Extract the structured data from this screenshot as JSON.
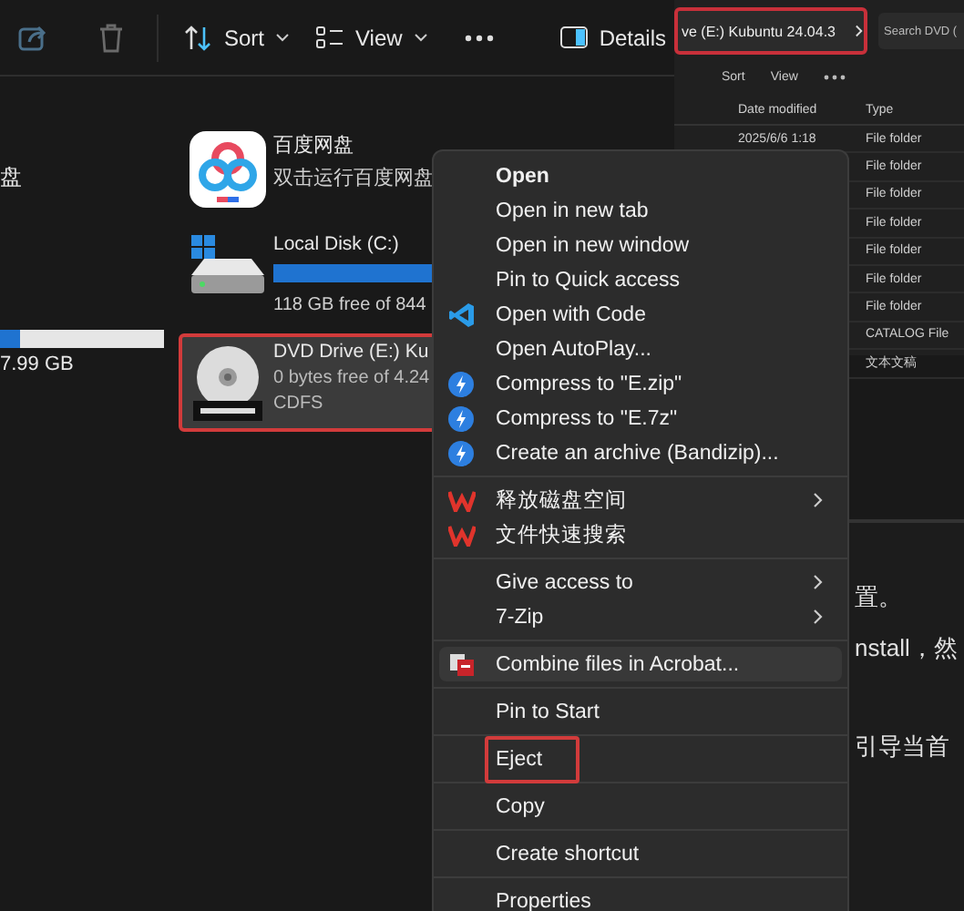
{
  "toolbar": {
    "sort": "Sort",
    "view": "View",
    "details": "Details"
  },
  "left_panel": {
    "label": "盘",
    "storage": {
      "level": 0.12
    },
    "storage_text": "7.99 GB"
  },
  "drives": [
    {
      "kind": "app",
      "name": "百度网盘",
      "lines": [
        "双击运行百度网盘"
      ],
      "selected": false,
      "marked": false
    },
    {
      "kind": "disk",
      "name": "Local Disk (C:)",
      "level": 0.86,
      "lines": [
        "118 GB free of 844"
      ],
      "selected": false,
      "marked": false
    },
    {
      "kind": "dvd",
      "name": "DVD Drive (E:) Ku",
      "lines": [
        "0 bytes free of 4.24",
        "CDFS"
      ],
      "selected": true,
      "marked": true
    }
  ],
  "inset_window": {
    "address": "ve (E:) Kubuntu 24.04.3",
    "address_marked": true,
    "search_placeholder": "Search DVD (",
    "sort": "Sort",
    "view": "View",
    "columns": [
      "Date modified",
      "Type"
    ],
    "rows": [
      {
        "date": "2025/6/6 1:18",
        "type": "File folder"
      },
      {
        "type": "File folder"
      },
      {
        "type": "File folder"
      },
      {
        "type": "File folder"
      },
      {
        "type": "File folder"
      },
      {
        "type": "File folder"
      },
      {
        "type": "File folder"
      },
      {
        "type": "CATALOG File"
      },
      {
        "type": "文本文稿"
      }
    ]
  },
  "document_lines": [
    "置。",
    "nstall，然",
    "引导当首"
  ],
  "context_menu": {
    "groups": [
      [
        {
          "label": "Open",
          "kind": "plain",
          "submenu": false,
          "selected": false,
          "marked": false
        },
        {
          "label": "Open in new tab",
          "kind": "plain",
          "submenu": false,
          "selected": false,
          "marked": false
        },
        {
          "label": "Open in new window",
          "kind": "plain",
          "submenu": false,
          "selected": false,
          "marked": false
        },
        {
          "label": "Pin to Quick access",
          "kind": "plain",
          "submenu": false,
          "selected": false,
          "marked": false
        },
        {
          "label": "Open with Code",
          "kind": "code",
          "submenu": false,
          "selected": false,
          "marked": false
        },
        {
          "label": "Open AutoPlay...",
          "kind": "plain",
          "submenu": false,
          "selected": false,
          "marked": false
        },
        {
          "label": "Compress to \"E.zip\"",
          "kind": "bandizip",
          "submenu": false,
          "selected": false,
          "marked": false
        },
        {
          "label": "Compress to \"E.7z\"",
          "kind": "bandizip",
          "submenu": false,
          "selected": false,
          "marked": false
        },
        {
          "label": "Create an archive (Bandizip)...",
          "kind": "bandizip",
          "submenu": false,
          "selected": false,
          "marked": false
        }
      ],
      [
        {
          "label": "释放磁盘空间",
          "kind": "wps",
          "submenu": true,
          "selected": false,
          "marked": false
        },
        {
          "label": "文件快速搜索",
          "kind": "wps",
          "submenu": false,
          "selected": false,
          "marked": false
        }
      ],
      [
        {
          "label": "Give access to",
          "kind": "plain",
          "submenu": true,
          "selected": false,
          "marked": false
        },
        {
          "label": "7-Zip",
          "kind": "plain",
          "submenu": true,
          "selected": false,
          "marked": false
        }
      ],
      [
        {
          "label": "Combine files in Acrobat...",
          "kind": "acrobat",
          "submenu": false,
          "selected": true,
          "marked": false
        }
      ],
      [
        {
          "label": "Pin to Start",
          "kind": "plain",
          "submenu": false,
          "selected": false,
          "marked": false
        }
      ],
      [
        {
          "label": "Eject",
          "kind": "plain",
          "submenu": false,
          "selected": false,
          "marked": true
        }
      ],
      [
        {
          "label": "Copy",
          "kind": "plain",
          "submenu": false,
          "selected": false,
          "marked": false
        }
      ],
      [
        {
          "label": "Create shortcut",
          "kind": "plain",
          "submenu": false,
          "selected": false,
          "marked": false
        }
      ],
      [
        {
          "label": "Properties",
          "kind": "plain",
          "submenu": false,
          "selected": false,
          "marked": false
        }
      ]
    ]
  }
}
